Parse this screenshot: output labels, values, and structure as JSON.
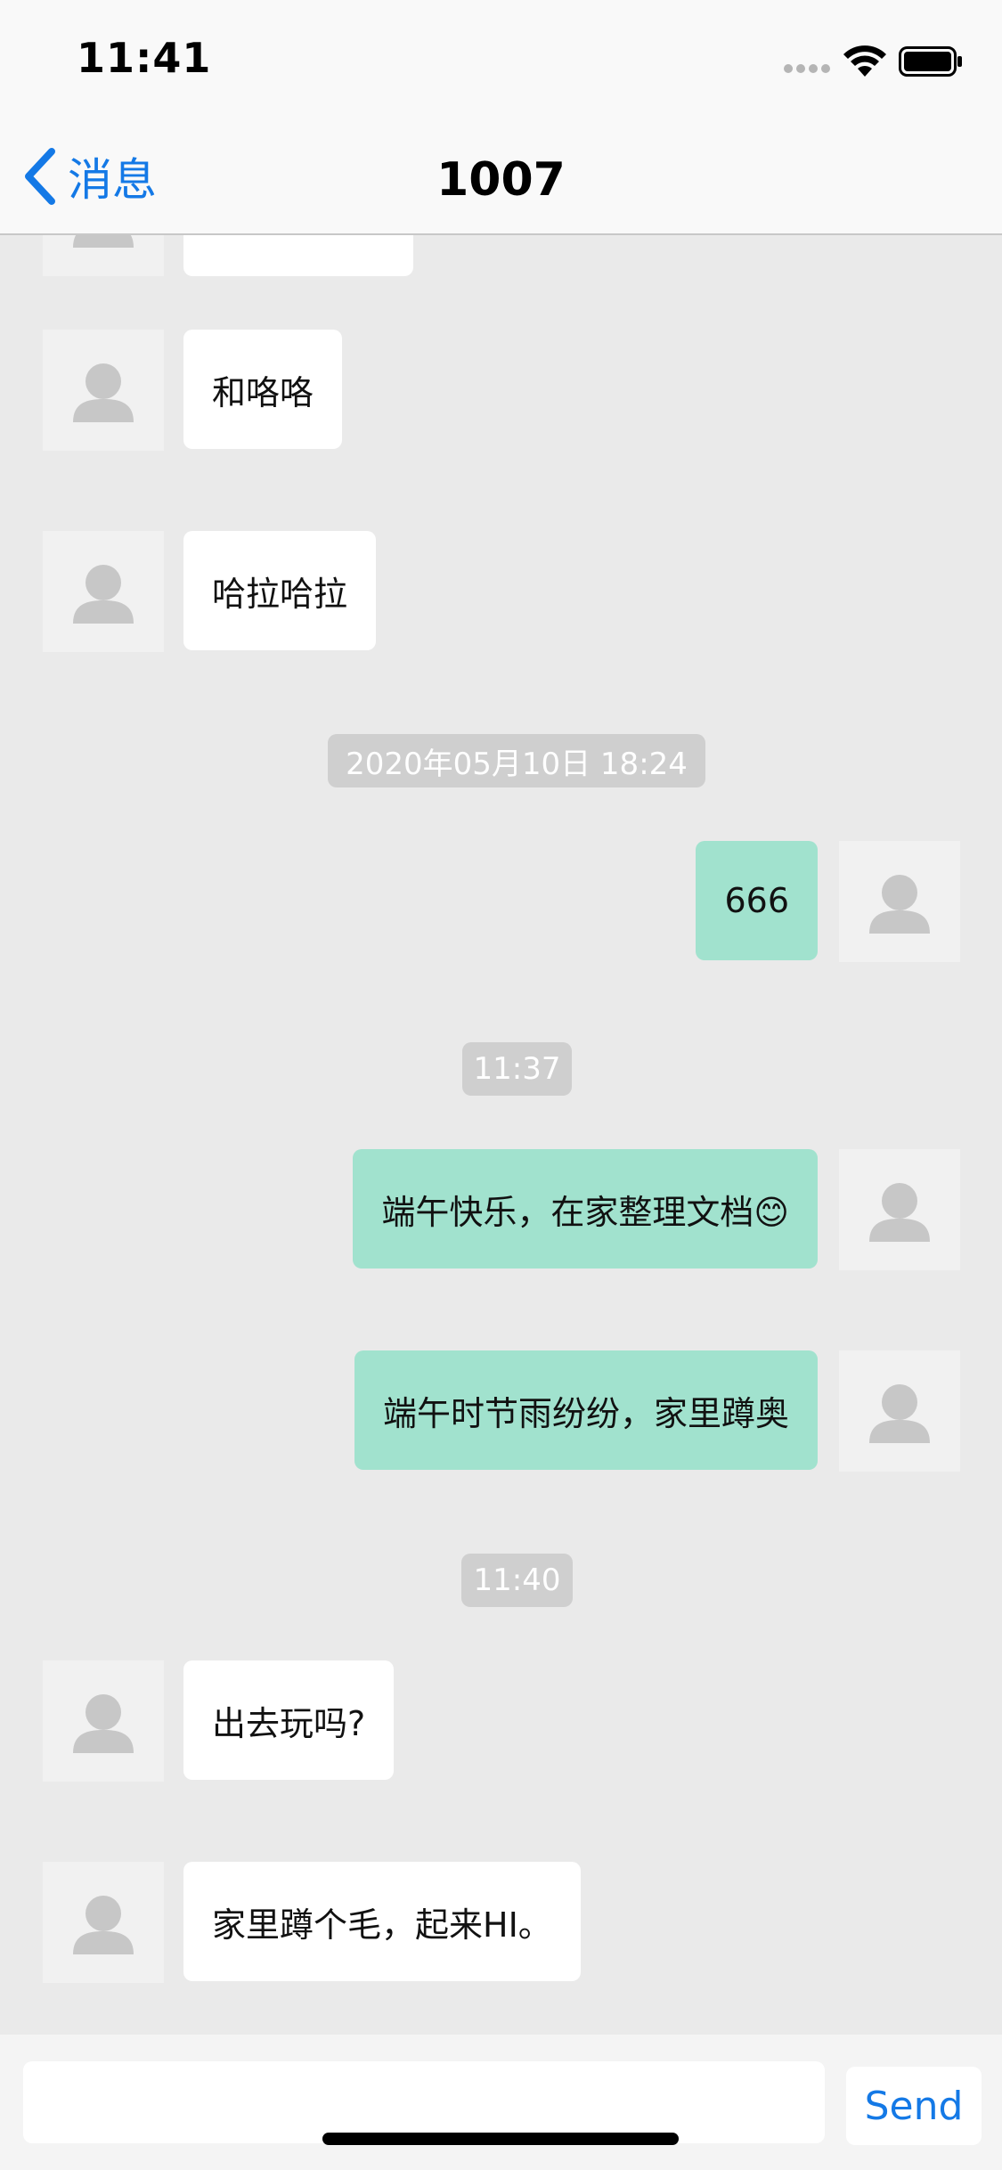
{
  "status_bar": {
    "time": "11:41"
  },
  "nav": {
    "back_label": "消息",
    "title": "1007"
  },
  "icons": {
    "back": "chevron-left-icon",
    "avatar": "person-silhouette-icon",
    "wifi": "wifi-icon",
    "battery": "battery-icon"
  },
  "colors": {
    "accent": "#1479E6",
    "outgoing_bubble": "#A1E2CE",
    "incoming_bubble": "#FFFFFF",
    "chat_background": "#EAEAEA",
    "timestamp_pill": "#CFCFCF"
  },
  "messages": [
    {
      "sender": "other",
      "text": ""
    },
    {
      "sender": "other",
      "text": "和咯咯"
    },
    {
      "sender": "other",
      "text": "哈拉哈拉"
    },
    {
      "type": "timestamp",
      "text": "2020年05月10日 18:24"
    },
    {
      "sender": "me",
      "text": "666"
    },
    {
      "type": "timestamp",
      "text": "11:37"
    },
    {
      "sender": "me",
      "text": "端午快乐，在家整理文档😊"
    },
    {
      "sender": "me",
      "text": "端午时节雨纷纷，家里蹲奥"
    },
    {
      "type": "timestamp",
      "text": "11:40"
    },
    {
      "sender": "other",
      "text": "出去玩吗?"
    },
    {
      "sender": "other",
      "text": "家里蹲个毛，起来HI。"
    }
  ],
  "input": {
    "value": "",
    "placeholder": ""
  },
  "send_label": "Send"
}
